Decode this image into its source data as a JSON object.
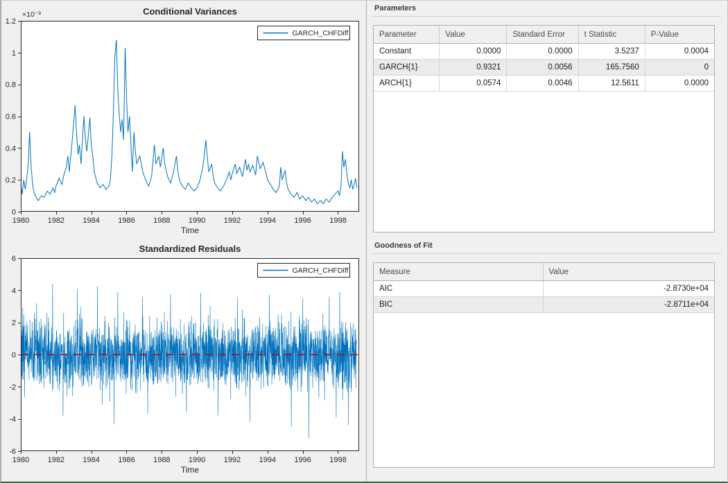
{
  "colors": {
    "background": "#f0f0f0",
    "series_blue": "#0072BD",
    "zero_line_red": "#A2142F",
    "axis": "#262626"
  },
  "panels": {
    "parameters": {
      "title": "Parameters",
      "columns": [
        "Parameter",
        "Value",
        "Standard Error",
        "t Statistic",
        "P-Value"
      ],
      "rows": [
        [
          "Constant",
          "0.0000",
          "0.0000",
          "3.5237",
          "0.0004"
        ],
        [
          "GARCH{1}",
          "0.9321",
          "0.0056",
          "165.7560",
          "0"
        ],
        [
          "ARCH{1}",
          "0.0574",
          "0.0046",
          "12.5611",
          "0.0000"
        ]
      ]
    },
    "goodness_of_fit": {
      "title": "Goodness of Fit",
      "columns": [
        "Measure",
        "Value"
      ],
      "rows": [
        [
          "AIC",
          "-2.8730e+04"
        ],
        [
          "BIC",
          "-2.8711e+04"
        ]
      ]
    }
  },
  "chart_data": [
    {
      "id": "conditional_variances",
      "type": "line",
      "title": "Conditional Variances",
      "xlabel": "Time",
      "ylabel": "",
      "y_exponent_label": "×10⁻³",
      "xlim": [
        1980,
        1999.2
      ],
      "ylim": [
        0,
        1.2
      ],
      "x_ticks": [
        1980,
        1982,
        1984,
        1986,
        1988,
        1990,
        1992,
        1994,
        1996,
        1998
      ],
      "y_ticks": [
        0,
        0.2,
        0.4,
        0.6,
        0.8,
        1,
        1.2
      ],
      "y_tick_labels": [
        "0",
        "0.2",
        "0.4",
        "0.6",
        "0.8",
        "1",
        "1.2"
      ],
      "grid": false,
      "legend": {
        "label": "GARCH_CHFDiff",
        "position": "northeast"
      },
      "line_color": "#0072BD",
      "units_note": "y values in 1e-3",
      "series": [
        {
          "name": "GARCH_CHFDiff",
          "points": [
            [
              1980.0,
              0.17
            ],
            [
              1980.08,
              0.11
            ],
            [
              1980.17,
              0.2
            ],
            [
              1980.25,
              0.14
            ],
            [
              1980.35,
              0.22
            ],
            [
              1980.42,
              0.3
            ],
            [
              1980.5,
              0.5
            ],
            [
              1980.58,
              0.3
            ],
            [
              1980.67,
              0.17
            ],
            [
              1980.75,
              0.12
            ],
            [
              1980.83,
              0.1
            ],
            [
              1980.92,
              0.08
            ],
            [
              1981.0,
              0.07
            ],
            [
              1981.17,
              0.1
            ],
            [
              1981.33,
              0.09
            ],
            [
              1981.5,
              0.13
            ],
            [
              1981.67,
              0.11
            ],
            [
              1981.83,
              0.15
            ],
            [
              1981.92,
              0.12
            ],
            [
              1982.0,
              0.16
            ],
            [
              1982.17,
              0.21
            ],
            [
              1982.33,
              0.17
            ],
            [
              1982.42,
              0.22
            ],
            [
              1982.58,
              0.28
            ],
            [
              1982.67,
              0.35
            ],
            [
              1982.75,
              0.25
            ],
            [
              1982.92,
              0.45
            ],
            [
              1983.08,
              0.67
            ],
            [
              1983.17,
              0.48
            ],
            [
              1983.25,
              0.36
            ],
            [
              1983.33,
              0.42
            ],
            [
              1983.42,
              0.3
            ],
            [
              1983.58,
              0.6
            ],
            [
              1983.67,
              0.45
            ],
            [
              1983.75,
              0.38
            ],
            [
              1983.92,
              0.59
            ],
            [
              1984.0,
              0.42
            ],
            [
              1984.08,
              0.35
            ],
            [
              1984.17,
              0.25
            ],
            [
              1984.33,
              0.18
            ],
            [
              1984.5,
              0.15
            ],
            [
              1984.67,
              0.17
            ],
            [
              1984.83,
              0.14
            ],
            [
              1985.0,
              0.16
            ],
            [
              1985.08,
              0.2
            ],
            [
              1985.17,
              0.35
            ],
            [
              1985.25,
              0.6
            ],
            [
              1985.33,
              0.97
            ],
            [
              1985.42,
              1.08
            ],
            [
              1985.5,
              0.78
            ],
            [
              1985.58,
              0.62
            ],
            [
              1985.67,
              0.5
            ],
            [
              1985.75,
              0.58
            ],
            [
              1985.83,
              0.45
            ],
            [
              1985.92,
              1.03
            ],
            [
              1986.0,
              0.72
            ],
            [
              1986.08,
              0.5
            ],
            [
              1986.17,
              0.6
            ],
            [
              1986.25,
              0.42
            ],
            [
              1986.33,
              0.25
            ],
            [
              1986.42,
              0.5
            ],
            [
              1986.5,
              0.38
            ],
            [
              1986.58,
              0.3
            ],
            [
              1986.75,
              0.35
            ],
            [
              1986.92,
              0.25
            ],
            [
              1987.08,
              0.2
            ],
            [
              1987.25,
              0.16
            ],
            [
              1987.42,
              0.22
            ],
            [
              1987.58,
              0.42
            ],
            [
              1987.67,
              0.3
            ],
            [
              1987.83,
              0.35
            ],
            [
              1987.92,
              0.28
            ],
            [
              1988.08,
              0.4
            ],
            [
              1988.17,
              0.3
            ],
            [
              1988.33,
              0.22
            ],
            [
              1988.5,
              0.18
            ],
            [
              1988.67,
              0.25
            ],
            [
              1988.83,
              0.35
            ],
            [
              1988.92,
              0.25
            ],
            [
              1989.0,
              0.2
            ],
            [
              1989.17,
              0.16
            ],
            [
              1989.33,
              0.14
            ],
            [
              1989.5,
              0.18
            ],
            [
              1989.67,
              0.15
            ],
            [
              1989.83,
              0.13
            ],
            [
              1990.0,
              0.15
            ],
            [
              1990.17,
              0.2
            ],
            [
              1990.33,
              0.28
            ],
            [
              1990.5,
              0.45
            ],
            [
              1990.58,
              0.35
            ],
            [
              1990.67,
              0.25
            ],
            [
              1990.83,
              0.3
            ],
            [
              1990.92,
              0.22
            ],
            [
              1991.0,
              0.18
            ],
            [
              1991.17,
              0.15
            ],
            [
              1991.33,
              0.13
            ],
            [
              1991.5,
              0.16
            ],
            [
              1991.67,
              0.2
            ],
            [
              1991.83,
              0.25
            ],
            [
              1991.92,
              0.2
            ],
            [
              1992.0,
              0.24
            ],
            [
              1992.17,
              0.3
            ],
            [
              1992.25,
              0.24
            ],
            [
              1992.42,
              0.28
            ],
            [
              1992.58,
              0.22
            ],
            [
              1992.75,
              0.33
            ],
            [
              1992.83,
              0.26
            ],
            [
              1992.92,
              0.3
            ],
            [
              1993.0,
              0.25
            ],
            [
              1993.17,
              0.29
            ],
            [
              1993.33,
              0.23
            ],
            [
              1993.42,
              0.35
            ],
            [
              1993.58,
              0.27
            ],
            [
              1993.75,
              0.31
            ],
            [
              1993.92,
              0.24
            ],
            [
              1994.0,
              0.2
            ],
            [
              1994.17,
              0.17
            ],
            [
              1994.33,
              0.14
            ],
            [
              1994.5,
              0.12
            ],
            [
              1994.67,
              0.16
            ],
            [
              1994.75,
              0.28
            ],
            [
              1994.83,
              0.2
            ],
            [
              1995.0,
              0.26
            ],
            [
              1995.08,
              0.18
            ],
            [
              1995.17,
              0.14
            ],
            [
              1995.33,
              0.11
            ],
            [
              1995.5,
              0.09
            ],
            [
              1995.67,
              0.12
            ],
            [
              1995.83,
              0.08
            ],
            [
              1996.0,
              0.1
            ],
            [
              1996.17,
              0.07
            ],
            [
              1996.33,
              0.09
            ],
            [
              1996.5,
              0.06
            ],
            [
              1996.67,
              0.08
            ],
            [
              1996.83,
              0.05
            ],
            [
              1997.0,
              0.07
            ],
            [
              1997.17,
              0.05
            ],
            [
              1997.33,
              0.08
            ],
            [
              1997.5,
              0.06
            ],
            [
              1997.67,
              0.09
            ],
            [
              1997.83,
              0.11
            ],
            [
              1998.0,
              0.13
            ],
            [
              1998.08,
              0.1
            ],
            [
              1998.17,
              0.16
            ],
            [
              1998.25,
              0.38
            ],
            [
              1998.33,
              0.28
            ],
            [
              1998.42,
              0.33
            ],
            [
              1998.5,
              0.24
            ],
            [
              1998.58,
              0.18
            ],
            [
              1998.67,
              0.15
            ],
            [
              1998.75,
              0.2
            ],
            [
              1998.83,
              0.14
            ],
            [
              1998.92,
              0.17
            ],
            [
              1999.0,
              0.21
            ],
            [
              1999.08,
              0.15
            ]
          ]
        }
      ]
    },
    {
      "id": "standardized_residuals",
      "type": "line",
      "title": "Standardized Residuals",
      "xlabel": "Time",
      "ylabel": "",
      "y_exponent_label": "",
      "xlim": [
        1980,
        1999.2
      ],
      "ylim": [
        -6,
        6
      ],
      "x_ticks": [
        1980,
        1982,
        1984,
        1986,
        1988,
        1990,
        1992,
        1994,
        1996,
        1998
      ],
      "y_ticks": [
        -6,
        -4,
        -2,
        0,
        2,
        4,
        6
      ],
      "y_tick_labels": [
        "-6",
        "-4",
        "-2",
        "0",
        "2",
        "4",
        "6"
      ],
      "grid": false,
      "legend": {
        "label": "GARCH_CHFDiff",
        "position": "northeast"
      },
      "line_color": "#0072BD",
      "zero_line": {
        "y": 0,
        "color": "#A2142F",
        "style": "dashed"
      },
      "series": [
        {
          "name": "GARCH_CHFDiff",
          "noise": {
            "seed": 7,
            "n": 2400,
            "x_range": [
              1980,
              1999.05
            ],
            "mean": 0,
            "approx_std": 1.0,
            "clip": [
              -5.2,
              4.5
            ]
          },
          "extremes": [
            [
              1980.9,
              3.2
            ],
            [
              1981.8,
              4.4
            ],
            [
              1982.4,
              -3.8
            ],
            [
              1983.2,
              4.1
            ],
            [
              1984.35,
              4.25
            ],
            [
              1985.3,
              -4.3
            ],
            [
              1985.5,
              3.9
            ],
            [
              1986.9,
              3.6
            ],
            [
              1987.2,
              -3.7
            ],
            [
              1988.5,
              3.75
            ],
            [
              1989.4,
              -3.6
            ],
            [
              1990.2,
              3.85
            ],
            [
              1991.2,
              -3.8
            ],
            [
              1992.3,
              3.6
            ],
            [
              1993.0,
              -4.2
            ],
            [
              1994.1,
              3.7
            ],
            [
              1995.35,
              -4.5
            ],
            [
              1996.0,
              3.5
            ],
            [
              1996.35,
              -5.2
            ],
            [
              1997.5,
              3.6
            ],
            [
              1997.9,
              -3.9
            ],
            [
              1998.1,
              3.9
            ],
            [
              1998.6,
              -4.4
            ]
          ]
        }
      ]
    }
  ]
}
